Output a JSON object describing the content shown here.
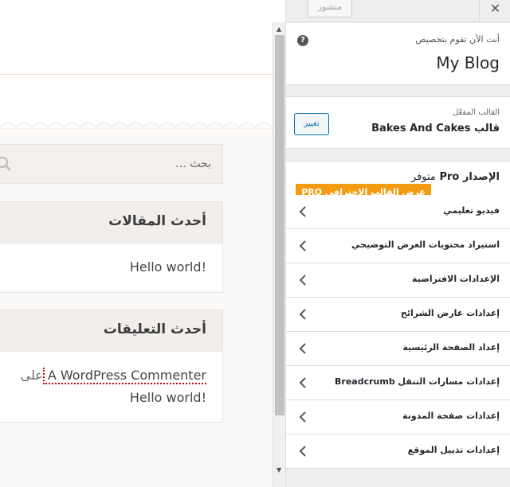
{
  "preview": {
    "search": {
      "placeholder": "بحث …"
    },
    "recent_posts": {
      "title": "أحدث المقالات",
      "items": [
        "Hello world!"
      ]
    },
    "recent_comments": {
      "title": "أحدث التعليقات",
      "author": "A WordPress Commenter",
      "on": "على",
      "post": "Hello world!"
    }
  },
  "panel": {
    "publish_label": "منشور",
    "close_glyph": "✕",
    "customizing_label": "أنت الآن تقوم بتخصيص",
    "site_title": "My Blog",
    "help_glyph": "?",
    "active_theme_label": "القالب المفعّل",
    "theme_name": "قالب Bakes And Cakes",
    "change_button": "تغيير",
    "pro_title_bold": "الإصدار Pro",
    "pro_title_light": "متوفر",
    "pro_button": "عرض القالب الاحترافي PRO",
    "sections": [
      "فيديو تعليمي",
      "استيراد محتويات العرض التوضيحي",
      "الإعدادات الافتراضية",
      "إعدادات عارض الشرائح",
      "إعداد الصفحة الرئيسية",
      "إعدادات مسارات التنقل Breadcrumb",
      "إعدادات صفحة المدونة",
      "إعدادات تذييل الموقع"
    ]
  },
  "colors": {
    "accent": "#0073aa",
    "pro": "#f39c12",
    "panel_bg": "#eeeeee"
  },
  "icons": [
    "search-icon",
    "close-icon",
    "help-icon",
    "chevron-left-icon",
    "scroll-arrow-up-icon",
    "scroll-arrow-down-icon"
  ]
}
